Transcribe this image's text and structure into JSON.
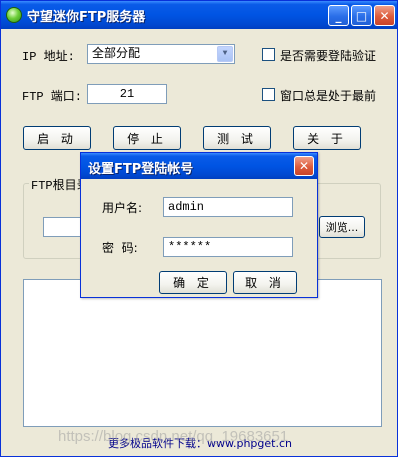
{
  "window": {
    "title": "守望迷你FTP服务器"
  },
  "settings": {
    "ip_label": "IP 地址:",
    "ip_value": "全部分配",
    "port_label": "FTP 端口:",
    "port_value": "21",
    "require_login_label": "是否需要登陆验证",
    "always_on_top_label": "窗口总是处于最前"
  },
  "buttons": {
    "start": "启 动",
    "stop": "停 止",
    "test": "测 试",
    "about": "关 于"
  },
  "root_dir": {
    "group_label": "FTP根目录",
    "browse": "浏览..."
  },
  "footer": "更多极品软件下载：www.phpget.cn",
  "watermark": "https://blog.csdn.net/qq_19683651",
  "dialog": {
    "title": "设置FTP登陆帐号",
    "username_label": "用户名:",
    "username_value": "admin",
    "password_label": "密  码:",
    "password_value": "******",
    "ok": "确 定",
    "cancel": "取 消"
  }
}
